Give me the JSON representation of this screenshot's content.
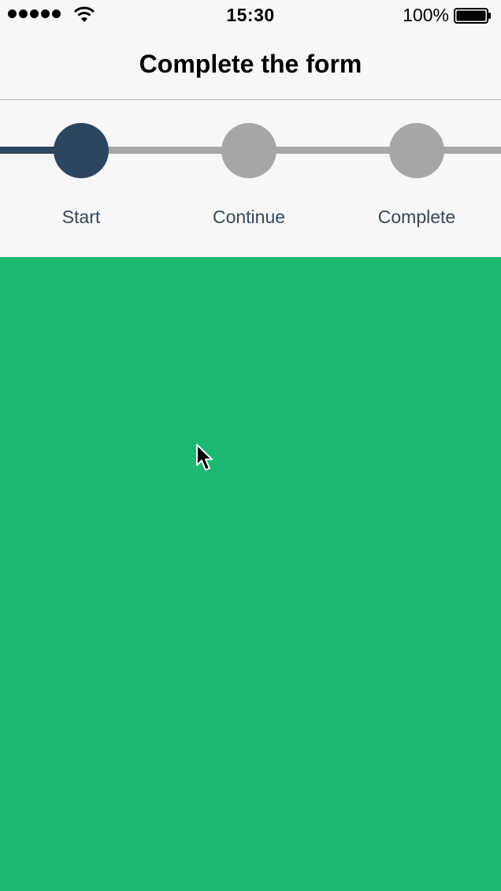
{
  "status_bar": {
    "time": "15:30",
    "battery_percent": "100%",
    "icons": [
      "signal-dots-icon",
      "wifi-icon",
      "battery-icon"
    ]
  },
  "nav": {
    "title": "Complete the form"
  },
  "stepper": {
    "current_step": 1,
    "steps": [
      {
        "label": "Start",
        "state": "active"
      },
      {
        "label": "Continue",
        "state": "inactive"
      },
      {
        "label": "Complete",
        "state": "inactive"
      }
    ]
  },
  "colors": {
    "active_step": "#2c4560",
    "inactive_step": "#a6a6a6",
    "step_label": "#34495e",
    "content_background": "#1db872",
    "bar_background": "#f7f7f7"
  },
  "cursor": {
    "icon": "mouse-pointer-icon"
  }
}
